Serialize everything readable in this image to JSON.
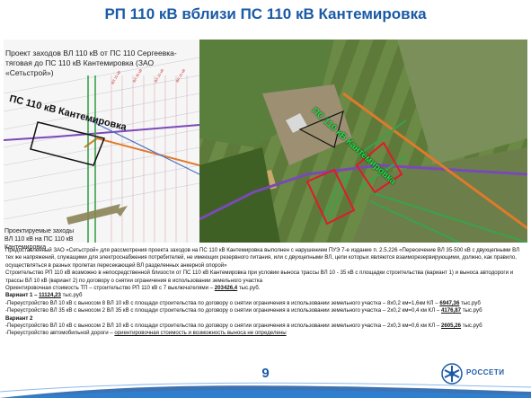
{
  "header": {
    "title": "РП 110 кВ вблизи ПС 110 кВ Кантемировка"
  },
  "left_map": {
    "description": "Проект заходов ВЛ 110 кВ от ПС 110 Сергеевка-тяговая до ПС 110 кВ Кантемировка (ЗАО «Сетьстрой»)",
    "substation_label": "ПС 110 кВ Кантемировка",
    "projected_label": "Проектируемые заходы ВЛ 110 кВ на ПС 110 кВ Кантемировка"
  },
  "satellite": {
    "substation_label": "ПС 110 кВ Кантемировка"
  },
  "body": {
    "p1": "Предоставленный ЗАО «Сетьстрой» для рассмотрения проекта заходов на ПС 110 кВ Кантемировка выполнен с нарушением ПУЭ 7-е издание п. 2.5.226 «Пересечение ВЛ 35-500 кВ с двухцепными ВЛ тех же напряжений, служащими для электроснабжения потребителей, не имеющих резервного питания, или с двухцепными ВЛ, цепи которых являются взаиморезервирующими, должно, как правило, осуществляться в разных пролетах пересекающей ВЛ разделенных анкерной опорой»",
    "p2": "Строительство РП 110 кВ возможно в непосредственной близости от ПС 110 кВ Кантемировка при условии выноса трассы ВЛ 10 - 35 кВ с площадки строительства (вариант 1) и выноса автодороги и трассы ВЛ 10 кВ (вариант 2) по договору о снятии ограничения в использовании земельного участка",
    "p3_prefix": "Ориентировочная стоимость ТП – строительство РП 110 кВ с 7 выключателями – ",
    "p3_value": "203426,4",
    "p3_suffix": " тыс.руб.",
    "v1_title": "Вариант 1 – ",
    "v1_value": "11124,23",
    "v1_suffix": " тыс.руб",
    "v1_line1": "-Переустройство ВЛ 10 кВ с выносом 8 ВЛ 10 кВ с площади строительства по договору о снятии ограничения в использовании земельного участка – 8х0,2 км=1,6км КЛ – ",
    "v1_line1_value": "6947,36",
    "v1_line1_suffix": " тыс.руб",
    "v1_line2": "-Переустройство ВЛ 35 кВ с выносом 2 ВЛ 35 кВ с площади строительства по договору о снятии ограничения в использовании земельного участка – 2х0,2 км=0,4 км КЛ – ",
    "v1_line2_value": "4176,87",
    "v1_line2_suffix": " тыс.руб",
    "v2_title": "Вариант 2",
    "v2_line1": "-Переустройство ВЛ 10 кВ с выносом 2 ВЛ 10 кВ с площади строительства по договору о снятии ограничения в использовании земельного участка – 2х0,3 км=0,6 км КЛ – ",
    "v2_line1_value": "2605,26",
    "v2_line1_suffix": " тыс.руб",
    "v2_line2_prefix": "-Переустройство автомобильной дороги – ",
    "v2_line2_value": "ориентировочная стоимость и возможность выноса не определены"
  },
  "footer": {
    "page_number": "9",
    "logo_text": "РОССЕТИ",
    "accent_color": "#1b5aa6"
  }
}
